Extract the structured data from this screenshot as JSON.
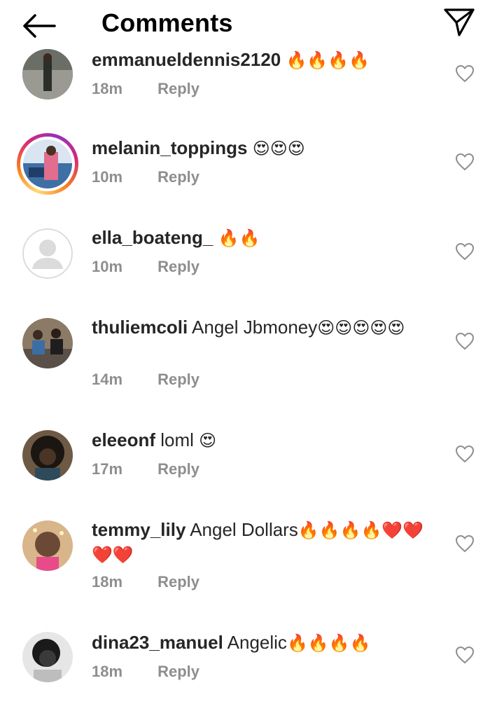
{
  "header": {
    "title": "Comments"
  },
  "comments": [
    {
      "username": "emmanueldennis2120",
      "text": "",
      "emoji": "🔥🔥🔥🔥",
      "time": "18m",
      "reply": "Reply",
      "avatar_colors": [
        "#6d6f63",
        "#3f4538"
      ]
    },
    {
      "username": "melanin_toppings",
      "text": "",
      "emoji": "😍😍😍",
      "time": "10m",
      "reply": "Reply",
      "avatar_colors": [
        "#4e7fb3",
        "#c8476b"
      ]
    },
    {
      "username": "ella_boateng_",
      "text": "",
      "emoji": "🔥🔥",
      "time": "10m",
      "reply": "Reply",
      "avatar_colors": [
        "#dbdbdb",
        "#ffffff"
      ]
    },
    {
      "username": "thuliemcoli",
      "text": "Angel Jbmoney",
      "emoji": "😍😍😍😍😍",
      "time": "14m",
      "reply": "Reply",
      "avatar_colors": [
        "#7a6a58",
        "#2c2c2c"
      ]
    },
    {
      "username": "eleeonf",
      "text": "loml",
      "emoji": "😍",
      "time": "17m",
      "reply": "Reply",
      "avatar_colors": [
        "#5a4a3a",
        "#1e1a16"
      ]
    },
    {
      "username": "temmy_lily",
      "text": "Angel Dollars",
      "emoji": "🔥🔥🔥🔥❤️❤️❤️❤️",
      "time": "18m",
      "reply": "Reply",
      "avatar_colors": [
        "#c9a67a",
        "#e84a8a"
      ]
    },
    {
      "username": "dina23_manuel",
      "text": "Angelic",
      "emoji": "🔥🔥🔥🔥",
      "time": "18m",
      "reply": "Reply",
      "avatar_colors": [
        "#d8d8d8",
        "#2a2a2a"
      ]
    }
  ],
  "icons": {
    "back": "arrow-left-icon",
    "send": "paper-plane-icon",
    "like": "heart-outline-icon"
  }
}
